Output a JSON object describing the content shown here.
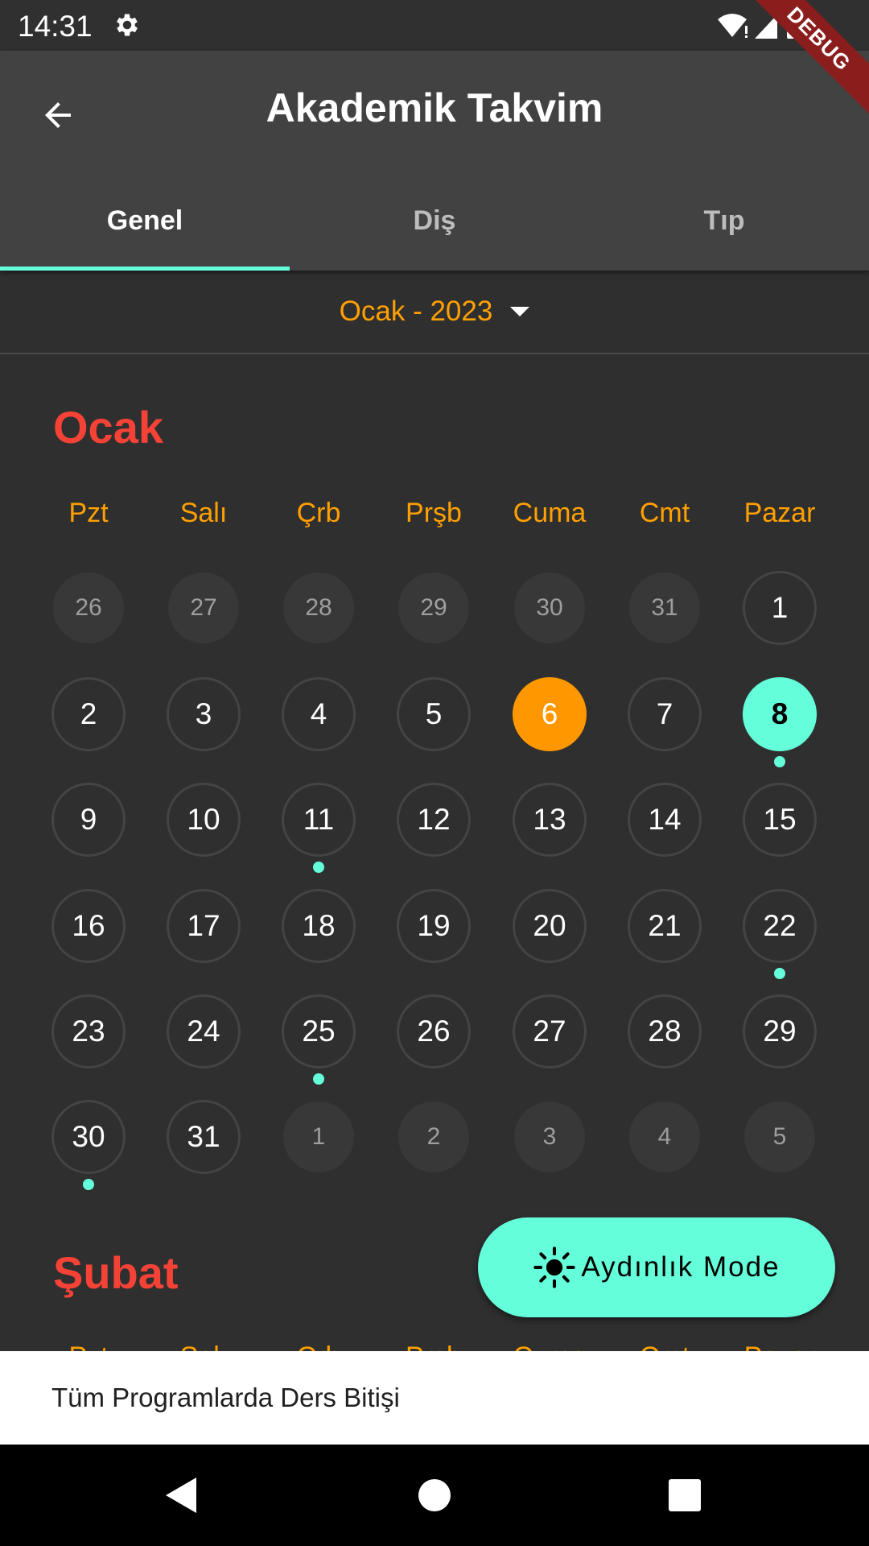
{
  "status_bar": {
    "time": "14:31",
    "icons": [
      "gear-icon",
      "wifi-icon",
      "signal-icon",
      "battery-icon"
    ],
    "debug_banner": "DEBUG"
  },
  "app_bar": {
    "title": "Akademik Takvim",
    "tabs": [
      {
        "label": "Genel",
        "active": true
      },
      {
        "label": "Diş",
        "active": false
      },
      {
        "label": "Tıp",
        "active": false
      }
    ]
  },
  "month_selector": {
    "value": "Ocak - 2023"
  },
  "calendar": {
    "months": [
      {
        "name": "Ocak",
        "weekdays": [
          "Pzt",
          "Salı",
          "Çrb",
          "Prşb",
          "Cuma",
          "Cmt",
          "Pazar"
        ],
        "weeks": [
          [
            {
              "d": "26",
              "o": true
            },
            {
              "d": "27",
              "o": true
            },
            {
              "d": "28",
              "o": true
            },
            {
              "d": "29",
              "o": true
            },
            {
              "d": "30",
              "o": true
            },
            {
              "d": "31",
              "o": true
            },
            {
              "d": "1"
            }
          ],
          [
            {
              "d": "2"
            },
            {
              "d": "3"
            },
            {
              "d": "4"
            },
            {
              "d": "5"
            },
            {
              "d": "6",
              "today": true
            },
            {
              "d": "7"
            },
            {
              "d": "8",
              "selected": true,
              "event": true
            }
          ],
          [
            {
              "d": "9"
            },
            {
              "d": "10"
            },
            {
              "d": "11",
              "event": true
            },
            {
              "d": "12"
            },
            {
              "d": "13"
            },
            {
              "d": "14"
            },
            {
              "d": "15"
            }
          ],
          [
            {
              "d": "16"
            },
            {
              "d": "17"
            },
            {
              "d": "18"
            },
            {
              "d": "19"
            },
            {
              "d": "20"
            },
            {
              "d": "21"
            },
            {
              "d": "22",
              "event": true
            }
          ],
          [
            {
              "d": "23"
            },
            {
              "d": "24"
            },
            {
              "d": "25",
              "event": true
            },
            {
              "d": "26"
            },
            {
              "d": "27"
            },
            {
              "d": "28"
            },
            {
              "d": "29"
            }
          ],
          [
            {
              "d": "30",
              "event": true
            },
            {
              "d": "31"
            },
            {
              "d": "1",
              "o": true
            },
            {
              "d": "2",
              "o": true
            },
            {
              "d": "3",
              "o": true
            },
            {
              "d": "4",
              "o": true
            },
            {
              "d": "5",
              "o": true
            }
          ]
        ]
      },
      {
        "name": "Şubat",
        "weekdays": [
          "Pzt",
          "Salı",
          "Çrb",
          "Prşb",
          "Cuma",
          "Cmt",
          "Pazar"
        ]
      }
    ]
  },
  "fab": {
    "label": "Aydınlık Mode",
    "icon": "sun-icon"
  },
  "snackbar": {
    "text": "Tüm Programlarda Ders Bitişi"
  },
  "nav_bar": {
    "buttons": [
      "back-triangle-icon",
      "home-circle-icon",
      "recents-square-icon"
    ]
  },
  "colors": {
    "accent": "#64ffda",
    "today": "#ff9800",
    "weekday": "#ffa000",
    "month_title": "#f44336",
    "background": "#2f2f2f",
    "app_bar": "#424242"
  }
}
